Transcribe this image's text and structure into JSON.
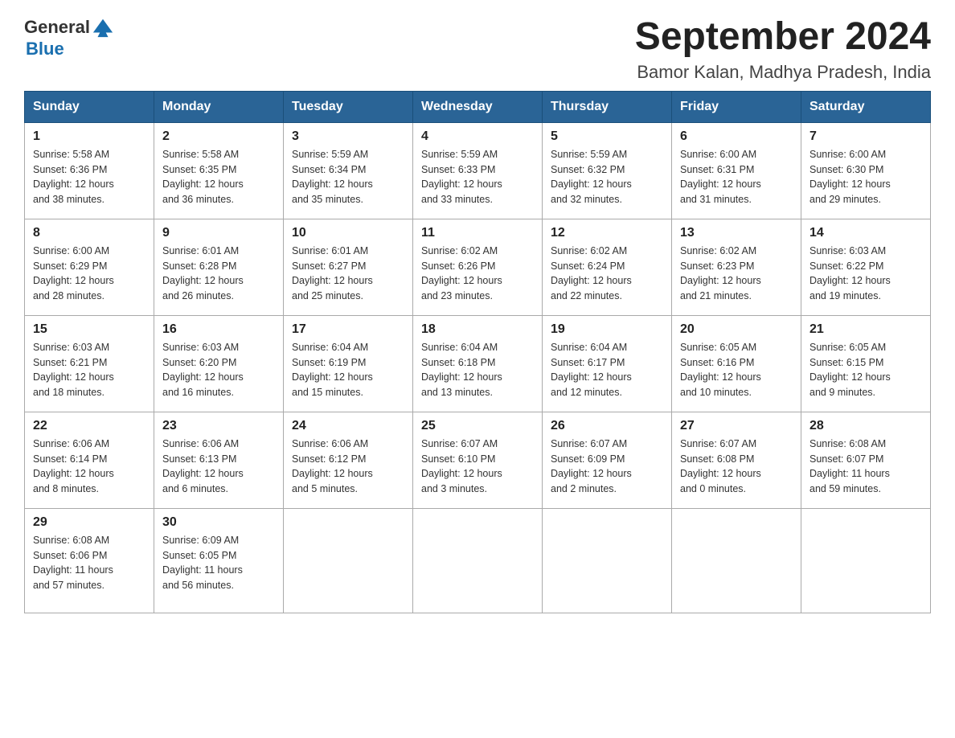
{
  "header": {
    "logo_general": "General",
    "logo_blue": "Blue",
    "title": "September 2024",
    "subtitle": "Bamor Kalan, Madhya Pradesh, India"
  },
  "weekdays": [
    "Sunday",
    "Monday",
    "Tuesday",
    "Wednesday",
    "Thursday",
    "Friday",
    "Saturday"
  ],
  "weeks": [
    [
      {
        "day": "1",
        "sunrise": "5:58 AM",
        "sunset": "6:36 PM",
        "daylight": "12 hours and 38 minutes."
      },
      {
        "day": "2",
        "sunrise": "5:58 AM",
        "sunset": "6:35 PM",
        "daylight": "12 hours and 36 minutes."
      },
      {
        "day": "3",
        "sunrise": "5:59 AM",
        "sunset": "6:34 PM",
        "daylight": "12 hours and 35 minutes."
      },
      {
        "day": "4",
        "sunrise": "5:59 AM",
        "sunset": "6:33 PM",
        "daylight": "12 hours and 33 minutes."
      },
      {
        "day": "5",
        "sunrise": "5:59 AM",
        "sunset": "6:32 PM",
        "daylight": "12 hours and 32 minutes."
      },
      {
        "day": "6",
        "sunrise": "6:00 AM",
        "sunset": "6:31 PM",
        "daylight": "12 hours and 31 minutes."
      },
      {
        "day": "7",
        "sunrise": "6:00 AM",
        "sunset": "6:30 PM",
        "daylight": "12 hours and 29 minutes."
      }
    ],
    [
      {
        "day": "8",
        "sunrise": "6:00 AM",
        "sunset": "6:29 PM",
        "daylight": "12 hours and 28 minutes."
      },
      {
        "day": "9",
        "sunrise": "6:01 AM",
        "sunset": "6:28 PM",
        "daylight": "12 hours and 26 minutes."
      },
      {
        "day": "10",
        "sunrise": "6:01 AM",
        "sunset": "6:27 PM",
        "daylight": "12 hours and 25 minutes."
      },
      {
        "day": "11",
        "sunrise": "6:02 AM",
        "sunset": "6:26 PM",
        "daylight": "12 hours and 23 minutes."
      },
      {
        "day": "12",
        "sunrise": "6:02 AM",
        "sunset": "6:24 PM",
        "daylight": "12 hours and 22 minutes."
      },
      {
        "day": "13",
        "sunrise": "6:02 AM",
        "sunset": "6:23 PM",
        "daylight": "12 hours and 21 minutes."
      },
      {
        "day": "14",
        "sunrise": "6:03 AM",
        "sunset": "6:22 PM",
        "daylight": "12 hours and 19 minutes."
      }
    ],
    [
      {
        "day": "15",
        "sunrise": "6:03 AM",
        "sunset": "6:21 PM",
        "daylight": "12 hours and 18 minutes."
      },
      {
        "day": "16",
        "sunrise": "6:03 AM",
        "sunset": "6:20 PM",
        "daylight": "12 hours and 16 minutes."
      },
      {
        "day": "17",
        "sunrise": "6:04 AM",
        "sunset": "6:19 PM",
        "daylight": "12 hours and 15 minutes."
      },
      {
        "day": "18",
        "sunrise": "6:04 AM",
        "sunset": "6:18 PM",
        "daylight": "12 hours and 13 minutes."
      },
      {
        "day": "19",
        "sunrise": "6:04 AM",
        "sunset": "6:17 PM",
        "daylight": "12 hours and 12 minutes."
      },
      {
        "day": "20",
        "sunrise": "6:05 AM",
        "sunset": "6:16 PM",
        "daylight": "12 hours and 10 minutes."
      },
      {
        "day": "21",
        "sunrise": "6:05 AM",
        "sunset": "6:15 PM",
        "daylight": "12 hours and 9 minutes."
      }
    ],
    [
      {
        "day": "22",
        "sunrise": "6:06 AM",
        "sunset": "6:14 PM",
        "daylight": "12 hours and 8 minutes."
      },
      {
        "day": "23",
        "sunrise": "6:06 AM",
        "sunset": "6:13 PM",
        "daylight": "12 hours and 6 minutes."
      },
      {
        "day": "24",
        "sunrise": "6:06 AM",
        "sunset": "6:12 PM",
        "daylight": "12 hours and 5 minutes."
      },
      {
        "day": "25",
        "sunrise": "6:07 AM",
        "sunset": "6:10 PM",
        "daylight": "12 hours and 3 minutes."
      },
      {
        "day": "26",
        "sunrise": "6:07 AM",
        "sunset": "6:09 PM",
        "daylight": "12 hours and 2 minutes."
      },
      {
        "day": "27",
        "sunrise": "6:07 AM",
        "sunset": "6:08 PM",
        "daylight": "12 hours and 0 minutes."
      },
      {
        "day": "28",
        "sunrise": "6:08 AM",
        "sunset": "6:07 PM",
        "daylight": "11 hours and 59 minutes."
      }
    ],
    [
      {
        "day": "29",
        "sunrise": "6:08 AM",
        "sunset": "6:06 PM",
        "daylight": "11 hours and 57 minutes."
      },
      {
        "day": "30",
        "sunrise": "6:09 AM",
        "sunset": "6:05 PM",
        "daylight": "11 hours and 56 minutes."
      },
      null,
      null,
      null,
      null,
      null
    ]
  ],
  "labels": {
    "sunrise": "Sunrise:",
    "sunset": "Sunset:",
    "daylight": "Daylight:"
  }
}
